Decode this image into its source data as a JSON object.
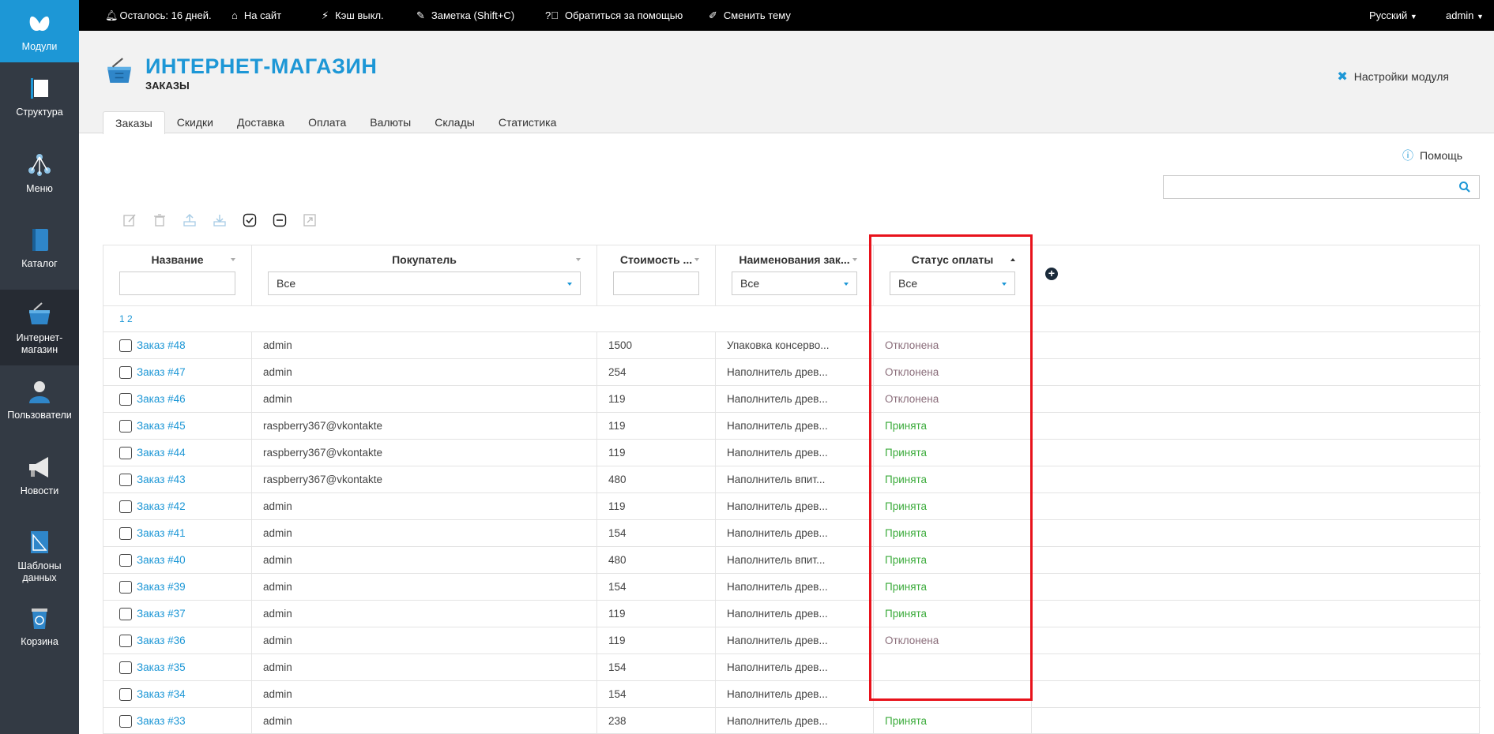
{
  "sidebar": {
    "items": [
      {
        "label": "Модули",
        "icon": "butterfly-icon"
      },
      {
        "label": "Структура",
        "icon": "structure-icon"
      },
      {
        "label": "Меню",
        "icon": "menu-tree-icon"
      },
      {
        "label": "Каталог",
        "icon": "book-icon"
      },
      {
        "label": "Интернет-\nмагазин",
        "line1": "Интернет-",
        "line2": "магазин",
        "icon": "basket-icon"
      },
      {
        "label": "Пользователи",
        "icon": "user-icon"
      },
      {
        "label": "Новости",
        "icon": "megaphone-icon"
      },
      {
        "label": "Шаблоны данных",
        "line1": "Шаблоны",
        "line2": "данных",
        "icon": "ruler-icon"
      },
      {
        "label": "Корзина",
        "icon": "trash-icon"
      }
    ]
  },
  "topbar": {
    "trial": "Осталось: 16 дней.",
    "site": "На сайт",
    "cache": "Кэш выкл.",
    "note": "Заметка (Shift+C)",
    "support": "Обратиться за помощью",
    "theme": "Сменить тему",
    "language": "Русский",
    "user": "admin"
  },
  "header": {
    "title": "ИНТЕРНЕТ-МАГАЗИН",
    "subtitle": "ЗАКАЗЫ",
    "settings": "Настройки модуля"
  },
  "tabs": [
    "Заказы",
    "Скидки",
    "Доставка",
    "Оплата",
    "Валюты",
    "Склады",
    "Статистика"
  ],
  "help": "Помощь",
  "search": {
    "placeholder": "",
    "value": ""
  },
  "grid": {
    "columns": {
      "name": "Название",
      "buyer": "Покупатель",
      "price": "Стоимость ...",
      "items": "Наименования зак...",
      "payment": "Статус оплаты"
    },
    "filters": {
      "buyer": "Все",
      "items": "Все",
      "payment": "Все"
    },
    "pager": "1 2",
    "rows": [
      {
        "name": "Заказ #48",
        "buyer": "admin",
        "price": "1500",
        "items": "Упаковка консерво...",
        "status": "Отклонена",
        "kind": "rej"
      },
      {
        "name": "Заказ #47",
        "buyer": "admin",
        "price": "254",
        "items": "Наполнитель древ...",
        "status": "Отклонена",
        "kind": "rej"
      },
      {
        "name": "Заказ #46",
        "buyer": "admin",
        "price": "119",
        "items": "Наполнитель древ...",
        "status": "Отклонена",
        "kind": "rej"
      },
      {
        "name": "Заказ #45",
        "buyer": "raspberry367@vkontakte",
        "price": "119",
        "items": "Наполнитель древ...",
        "status": "Принята",
        "kind": "ok"
      },
      {
        "name": "Заказ #44",
        "buyer": "raspberry367@vkontakte",
        "price": "119",
        "items": "Наполнитель древ...",
        "status": "Принята",
        "kind": "ok"
      },
      {
        "name": "Заказ #43",
        "buyer": "raspberry367@vkontakte",
        "price": "480",
        "items": "Наполнитель впит...",
        "status": "Принята",
        "kind": "ok"
      },
      {
        "name": "Заказ #42",
        "buyer": "admin",
        "price": "119",
        "items": "Наполнитель древ...",
        "status": "Принята",
        "kind": "ok"
      },
      {
        "name": "Заказ #41",
        "buyer": "admin",
        "price": "154",
        "items": "Наполнитель древ...",
        "status": "Принята",
        "kind": "ok"
      },
      {
        "name": "Заказ #40",
        "buyer": "admin",
        "price": "480",
        "items": "Наполнитель впит...",
        "status": "Принята",
        "kind": "ok"
      },
      {
        "name": "Заказ #39",
        "buyer": "admin",
        "price": "154",
        "items": "Наполнитель древ...",
        "status": "Принята",
        "kind": "ok"
      },
      {
        "name": "Заказ #37",
        "buyer": "admin",
        "price": "119",
        "items": "Наполнитель древ...",
        "status": "Принята",
        "kind": "ok"
      },
      {
        "name": "Заказ #36",
        "buyer": "admin",
        "price": "119",
        "items": "Наполнитель древ...",
        "status": "Отклонена",
        "kind": "rej"
      },
      {
        "name": "Заказ #35",
        "buyer": "admin",
        "price": "154",
        "items": "Наполнитель древ...",
        "status": "",
        "kind": "none"
      },
      {
        "name": "Заказ #34",
        "buyer": "admin",
        "price": "154",
        "items": "Наполнитель древ...",
        "status": "",
        "kind": "none"
      },
      {
        "name": "Заказ #33",
        "buyer": "admin",
        "price": "238",
        "items": "Наполнитель древ...",
        "status": "Принята",
        "kind": "ok"
      }
    ]
  },
  "colors": {
    "accent": "#1d97d6",
    "sidebar": "#333a44",
    "accepted": "#3bab3b",
    "rejected": "#8a6d7a",
    "highlight": "#e8121b"
  }
}
